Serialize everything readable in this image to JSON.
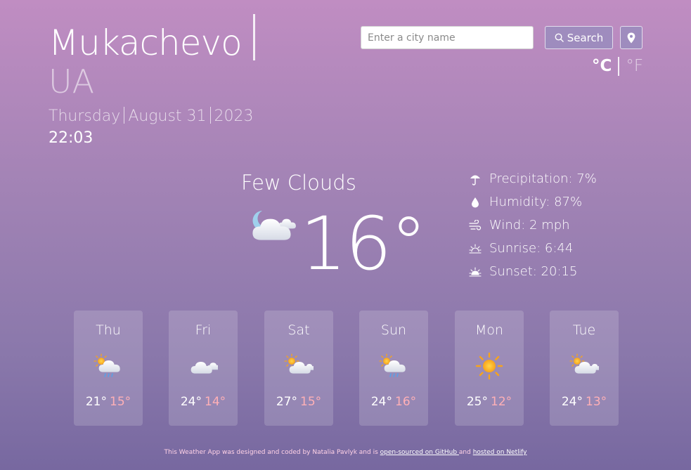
{
  "location": {
    "city": "Mukachevo",
    "country": "UA"
  },
  "date": {
    "weekday": "Thursday",
    "month_day": "August 31",
    "year": "2023",
    "time": "22:03"
  },
  "search": {
    "placeholder": "Enter a city name",
    "button_label": "Search"
  },
  "units": {
    "celsius": "°C",
    "fahrenheit": "°F",
    "active": "celsius"
  },
  "current": {
    "description": "Few Clouds",
    "temperature": "16°",
    "icon": "few-clouds-night-icon",
    "details": [
      {
        "icon": "umbrella-icon",
        "label": "Precipitation: 7%"
      },
      {
        "icon": "droplet-icon",
        "label": "Humidity: 87%"
      },
      {
        "icon": "wind-icon",
        "label": "Wind: 2 mph"
      },
      {
        "icon": "sunrise-icon",
        "label": "Sunrise: 6:44"
      },
      {
        "icon": "sunset-icon",
        "label": "Sunset: 20:15"
      }
    ]
  },
  "forecast": [
    {
      "day": "Thu",
      "max": "21°",
      "min": "15°",
      "icon": "sun-cloud-rain-icon"
    },
    {
      "day": "Fri",
      "max": "24°",
      "min": "14°",
      "icon": "cloud-icon"
    },
    {
      "day": "Sat",
      "max": "27°",
      "min": "15°",
      "icon": "sun-cloud-icon"
    },
    {
      "day": "Sun",
      "max": "24°",
      "min": "16°",
      "icon": "sun-cloud-rain-icon"
    },
    {
      "day": "Mon",
      "max": "25°",
      "min": "12°",
      "icon": "sun-icon"
    },
    {
      "day": "Tue",
      "max": "24°",
      "min": "13°",
      "icon": "sun-cloud-icon"
    }
  ],
  "footer": {
    "prefix": "This Weather App was designed and coded by Natalia Pavlyk and is ",
    "github_link": "open-sourced on GitHub ",
    "middle": "and ",
    "netlify_link": "hosted on Netlify"
  },
  "colors": {
    "gradient_top": "#c08dc2",
    "gradient_bottom": "#7768a0",
    "min_temp": "#ffb0b6"
  }
}
